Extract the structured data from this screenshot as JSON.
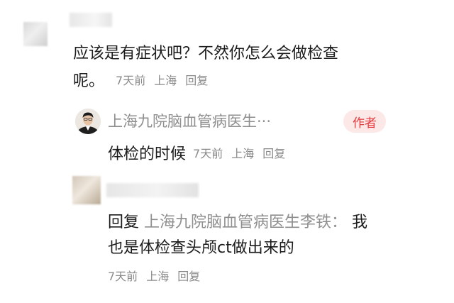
{
  "comment1": {
    "text": "应该是有症状吧？不然你怎么会做检查",
    "text_tail": "呢。",
    "time": "7天前",
    "location": "上海",
    "reply_label": "回复"
  },
  "reply1": {
    "author_name": "上海九院脑血管病医生···",
    "badge": "作者",
    "text": "体检的时候",
    "time": "7天前",
    "location": "上海",
    "reply_label": "回复"
  },
  "comment2": {
    "reply_prefix": "回复",
    "mention": "上海九院脑血管病医生李铁：",
    "text_line1_tail": "我",
    "text_line2": "也是体检查头颅ct做出来的",
    "time": "7天前",
    "location": "上海",
    "reply_label": "回复"
  }
}
